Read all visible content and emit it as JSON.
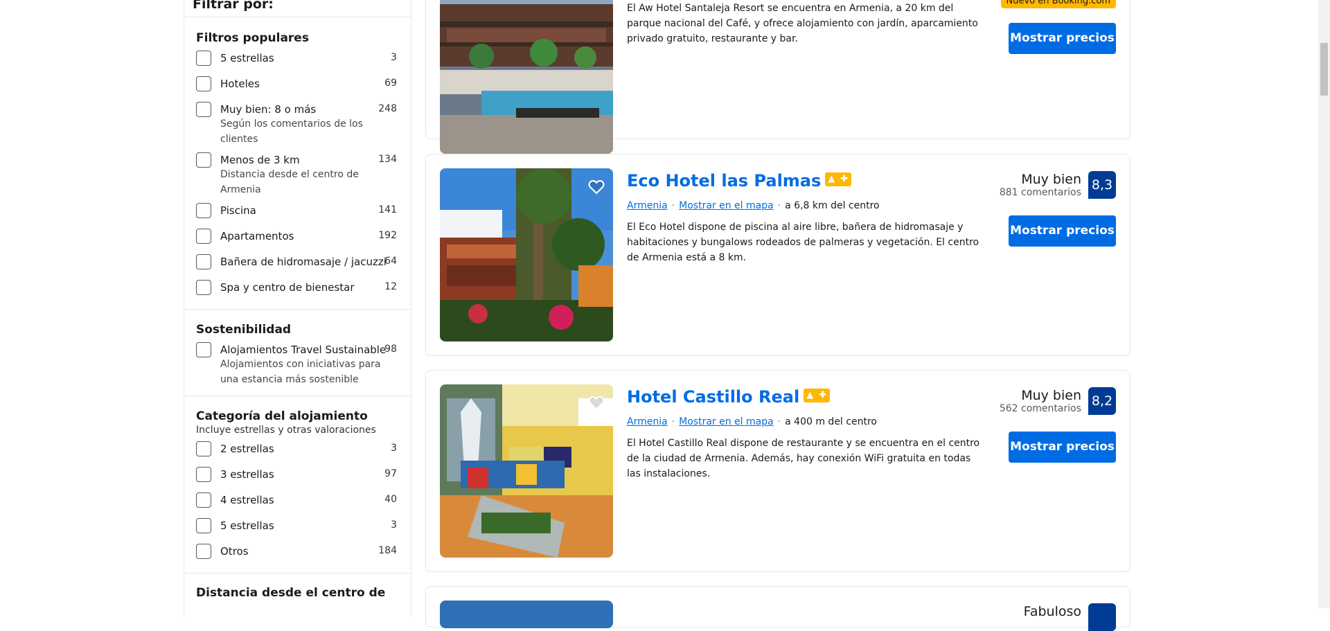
{
  "filters": {
    "header": "Filtrar por:",
    "groups": [
      {
        "title": "Filtros populares",
        "options": [
          {
            "label": "5 estrellas",
            "count": "3"
          },
          {
            "label": "Hoteles",
            "count": "69"
          },
          {
            "label": "Muy bien: 8 o más",
            "count": "248",
            "desc": "Según los comentarios de los clientes"
          },
          {
            "label": "Menos de 3 km",
            "count": "134",
            "desc": "Distancia desde el centro de Armenia"
          },
          {
            "label": "Piscina",
            "count": "141"
          },
          {
            "label": "Apartamentos",
            "count": "192"
          },
          {
            "label": "Bañera de hidromasaje / jacuzzi",
            "count": "64"
          },
          {
            "label": "Spa y centro de bienestar",
            "count": "12"
          }
        ]
      },
      {
        "title": "Sostenibilidad",
        "options": [
          {
            "label": "Alojamientos Travel Sustainable",
            "count": "98",
            "desc": "Alojamientos con iniciativas para una estancia más sostenible"
          }
        ]
      },
      {
        "title": "Categoría del alojamiento",
        "subtitle": "Incluye estrellas y otras valoraciones",
        "options": [
          {
            "label": "2 estrellas",
            "count": "3"
          },
          {
            "label": "3 estrellas",
            "count": "97"
          },
          {
            "label": "4 estrellas",
            "count": "40"
          },
          {
            "label": "5 estrellas",
            "count": "3"
          },
          {
            "label": "Otros",
            "count": "184"
          }
        ]
      },
      {
        "title": "Distancia desde el centro de"
      }
    ]
  },
  "results": [
    {
      "description": "El Aw Hotel Santaleja Resort se encuentra en Armenia, a 20 km del parque nacional del Café, y ofrece alojamiento con jardín, aparcamiento privado gratuito, restaurante y bar.",
      "new_badge": "Nuevo en Booking.com",
      "button": "Mostrar precios"
    },
    {
      "name": "Eco Hotel las Palmas",
      "city": "Armenia",
      "map_link": "Mostrar en el mapa",
      "distance": "a 6,8 km del centro",
      "description": "El Eco Hotel dispone de piscina al aire libre, bañera de hidromasaje y habitaciones y bungalows rodeados de palmeras y vegetación. El centro de Armenia está a 8 km.",
      "rating_word": "Muy bien",
      "reviews": "881 comentarios",
      "score": "8,3",
      "button": "Mostrar precios"
    },
    {
      "name": "Hotel Castillo Real",
      "city": "Armenia",
      "map_link": "Mostrar en el mapa",
      "distance": "a 400 m del centro",
      "description": "El Hotel Castillo Real dispone de restaurante y se encuentra en el centro de la ciudad de Armenia. Además, hay conexión WiFi gratuita en todas las instalaciones.",
      "rating_word": "Muy bien",
      "reviews": "562 comentarios",
      "score": "8,2",
      "button": "Mostrar precios"
    },
    {
      "rating_word": "Fabuloso"
    }
  ],
  "colors": {
    "link": "#006ce4",
    "score_bg": "#003b95",
    "badge": "#ffb700"
  },
  "icons": [
    "heart-icon",
    "thumbs-up-plus-icon"
  ]
}
